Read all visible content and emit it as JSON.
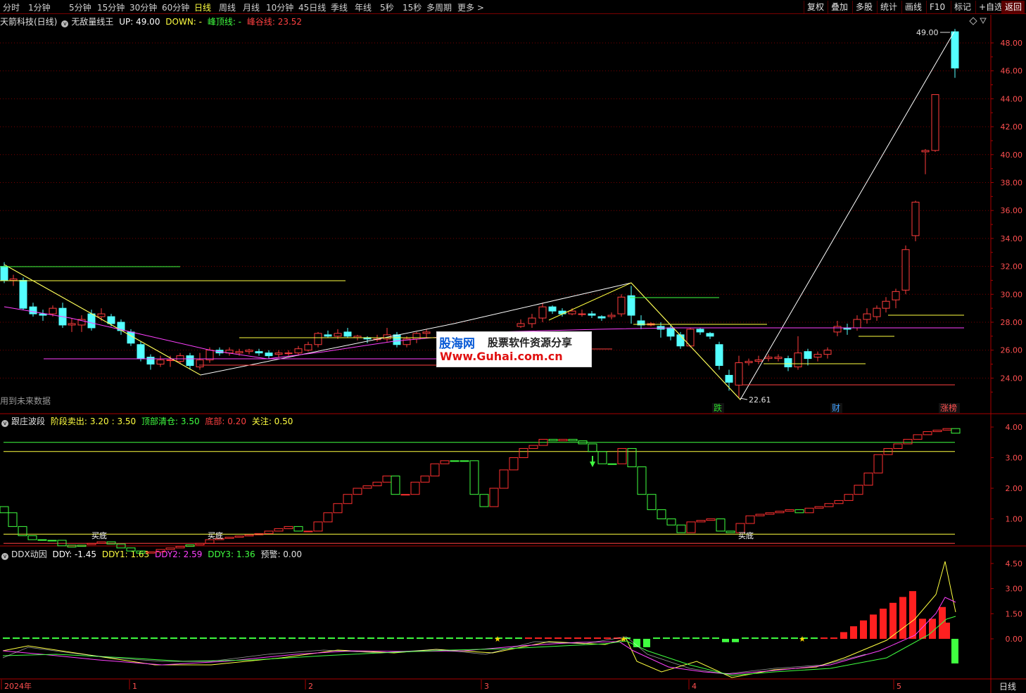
{
  "toolbar": {
    "timeframes": [
      "分时",
      "1分钟",
      "5分钟",
      "15分钟",
      "30分钟",
      "60分钟",
      "日线",
      "周线",
      "月线",
      "10分钟",
      "45日线",
      "季线",
      "年线",
      "5秒",
      "15秒",
      "多周期",
      "更多 >"
    ],
    "active_timeframe": "日线",
    "buttons": [
      "复权",
      "叠加",
      "多股",
      "统计",
      "画线",
      "F10",
      "标记",
      "+自选",
      "返回"
    ],
    "highlight_button": "返回"
  },
  "main_panel": {
    "stock": "天箭科技(日线)",
    "indicator": "无敌量线王",
    "up_label": "UP: 49.00",
    "down_label": "DOWN: -",
    "peak_label": "峰顶线: -",
    "valley_label": "峰谷线: 23.52",
    "future_note": "用到未来数据",
    "high_marker": "49.00",
    "low_marker": "22.61",
    "tags": [
      {
        "text": "跌",
        "color": "#2ad62a"
      },
      {
        "text": "财",
        "color": "#40a0ff"
      },
      {
        "text": "涨榜",
        "color": "#ff5050"
      }
    ],
    "y_ticks": [
      "48.00",
      "46.00",
      "44.00",
      "42.00",
      "40.00",
      "38.00",
      "36.00",
      "34.00",
      "32.00",
      "30.00",
      "28.00",
      "26.00",
      "24.00"
    ]
  },
  "watermark": {
    "logo": "股海网",
    "slogan": "股票软件资源分享",
    "url": "Www.Guhai.com.cn"
  },
  "panel2": {
    "name": "跟庄波段",
    "sell_label": "阶段卖出:",
    "sell_v1": "3.20",
    "sell_v2": ": 3.50",
    "top_label": "顶部清仓: 3.50",
    "bottom_label": "底部: 0.20",
    "watch_label": "关注: 0.50",
    "buy_text": "买底",
    "y_ticks": [
      "4.00",
      "3.00",
      "2.00",
      "1.00"
    ]
  },
  "panel3": {
    "name": "DDX动因",
    "ddy": "DDY: -1.45",
    "ddy1": "DDY1: 1.63",
    "ddy2": "DDY2: 2.59",
    "ddy3": "DDY3: 1.36",
    "alert": "预警: 0.00",
    "y_ticks": [
      "4.50",
      "3.00",
      "1.50",
      "0.00"
    ]
  },
  "time_axis": {
    "labels": [
      "2024年",
      "1",
      "2",
      "3",
      "4",
      "5"
    ],
    "period": "日线"
  },
  "colors": {
    "up": "#ff3c3c",
    "down": "#54ffff",
    "grid": "#7a0000",
    "active": "#ffff40"
  }
}
